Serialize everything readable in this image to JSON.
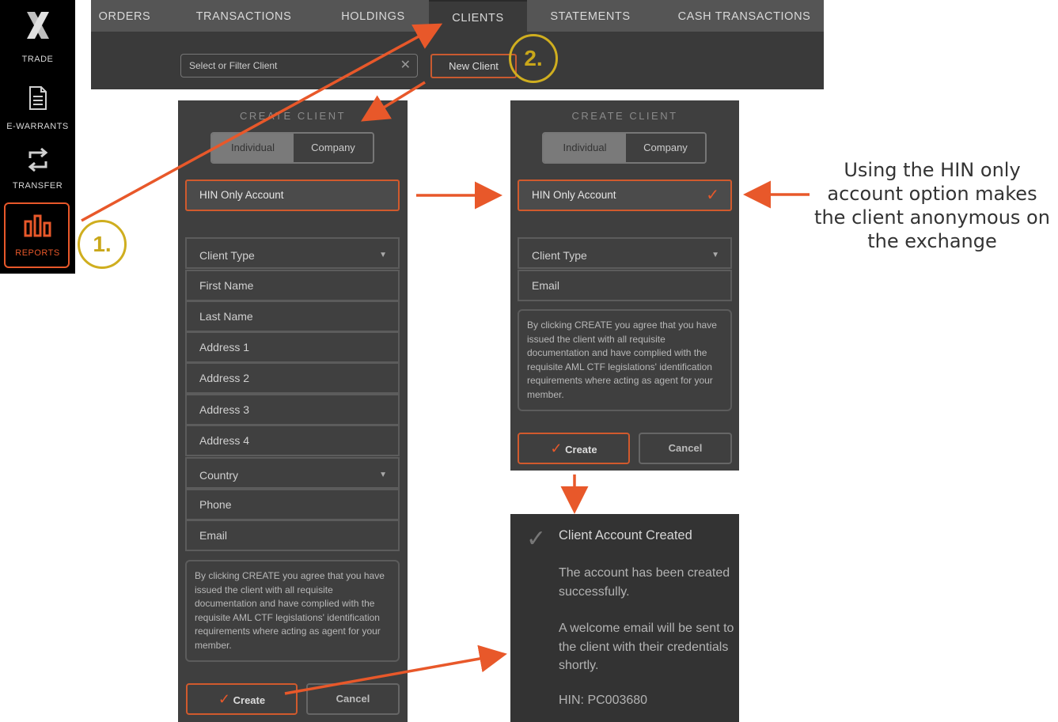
{
  "colors": {
    "accent": "#e8582a",
    "step_circle": "#cfae1f",
    "panel_bg": "#3f3f3f"
  },
  "sidebar": {
    "logo": "X",
    "items": [
      {
        "label": "TRADE",
        "icon": "x-logo-icon"
      },
      {
        "label": "E-WARRANTS",
        "icon": "document-icon"
      },
      {
        "label": "TRANSFER",
        "icon": "transfer-arrows-icon"
      },
      {
        "label": "REPORTS",
        "icon": "bar-chart-icon"
      }
    ]
  },
  "topnav": {
    "tabs": [
      "ORDERS",
      "TRANSACTIONS",
      "HOLDINGS",
      "CLIENTS",
      "STATEMENTS",
      "CASH TRANSACTIONS"
    ],
    "active_tab": "CLIENTS",
    "filter_placeholder": "Select or Filter Client",
    "new_client_label": "New Client"
  },
  "steps": {
    "one": "1.",
    "two": "2."
  },
  "form_full": {
    "title": "CREATE CLIENT",
    "segment": {
      "individual": "Individual",
      "company": "Company"
    },
    "hin_only": "HIN Only Account",
    "fields": [
      "Client Type",
      "First Name",
      "Last Name",
      "Address 1",
      "Address 2",
      "Address 3",
      "Address 4",
      "Country",
      "Phone",
      "Email"
    ],
    "notice": "By clicking CREATE you agree that you have issued the client with all requisite documentation and have complied with the requisite AML CTF legislations' identification requirements where acting as agent for your member.",
    "create_label": "Create",
    "cancel_label": "Cancel"
  },
  "form_hin": {
    "title": "CREATE CLIENT",
    "segment": {
      "individual": "Individual",
      "company": "Company"
    },
    "hin_only": "HIN Only Account",
    "fields": [
      "Client Type",
      "Email"
    ],
    "notice": "By clicking CREATE you agree that you have issued the client with all requisite documentation and have complied with the requisite AML CTF legislations' identification requirements where acting as agent for your member.",
    "create_label": "Create",
    "cancel_label": "Cancel"
  },
  "result": {
    "title": "Client Account Created",
    "line1": "The account has been created successfully.",
    "line2": "A welcome email will be sent to the client with their credentials shortly.",
    "hin": "HIN: PC003680"
  },
  "annotation": "Using the HIN only account option makes the client anonymous on the exchange"
}
